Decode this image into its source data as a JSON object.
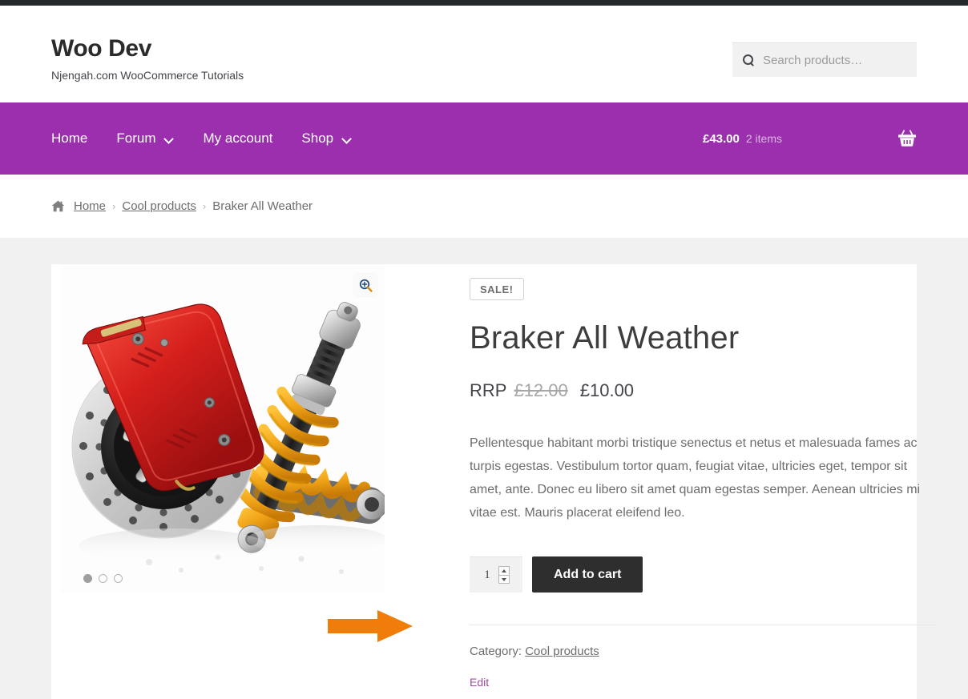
{
  "site": {
    "title": "Woo Dev",
    "description": "Njengah.com WooCommerce Tutorials"
  },
  "search": {
    "placeholder": "Search products…",
    "value": "",
    "icon": "search-icon"
  },
  "nav": {
    "items": [
      {
        "label": "Home",
        "has_dropdown": false
      },
      {
        "label": "Forum",
        "has_dropdown": true
      },
      {
        "label": "My account",
        "has_dropdown": false
      },
      {
        "label": "Shop",
        "has_dropdown": true
      }
    ],
    "background_color": "#9b2fae"
  },
  "cart": {
    "amount": "£43.00",
    "count": "2 items",
    "icon": "shopping-basket-icon"
  },
  "breadcrumb": {
    "home_icon": "home-icon",
    "items": [
      {
        "label": "Home",
        "is_link": true
      },
      {
        "label": "Cool products",
        "is_link": true
      },
      {
        "label": "Braker All Weather",
        "is_link": false
      }
    ],
    "separator": "›"
  },
  "product": {
    "sale_badge": "SALE!",
    "title": "Braker All Weather",
    "price": {
      "rrp_label": "RRP",
      "old": "£12.00",
      "new": "£10.00"
    },
    "description": "Pellentesque habitant morbi tristique senectus et netus et malesuada fames ac turpis egestas. Vestibulum tortor quam, feugiat vitae, ultricies eget, tempor sit amet, ante. Donec eu libero sit amet quam egestas semper. Aenean ultricies mi vitae est. Mauris placerat eleifend leo.",
    "quantity": "1",
    "add_to_cart_label": "Add to cart",
    "meta_label": "Category:",
    "meta_category": "Cool products",
    "edit_label": "Edit",
    "gallery": {
      "zoom_icon": "magnifier-plus-icon",
      "dots": [
        {
          "active": true
        },
        {
          "active": false
        },
        {
          "active": false
        }
      ],
      "image_alt": "Brake disc with red caliper and orange coilover suspension"
    }
  },
  "annotation": {
    "arrow_color": "#f07d0a",
    "points_to": "RRP price label"
  },
  "colors": {
    "nav_purple": "#9b2fae",
    "admin_bar": "#23282d",
    "content_bg": "#f1f1f1",
    "button_dark": "#2e2e2e",
    "edit_link": "#9b4f9b"
  }
}
